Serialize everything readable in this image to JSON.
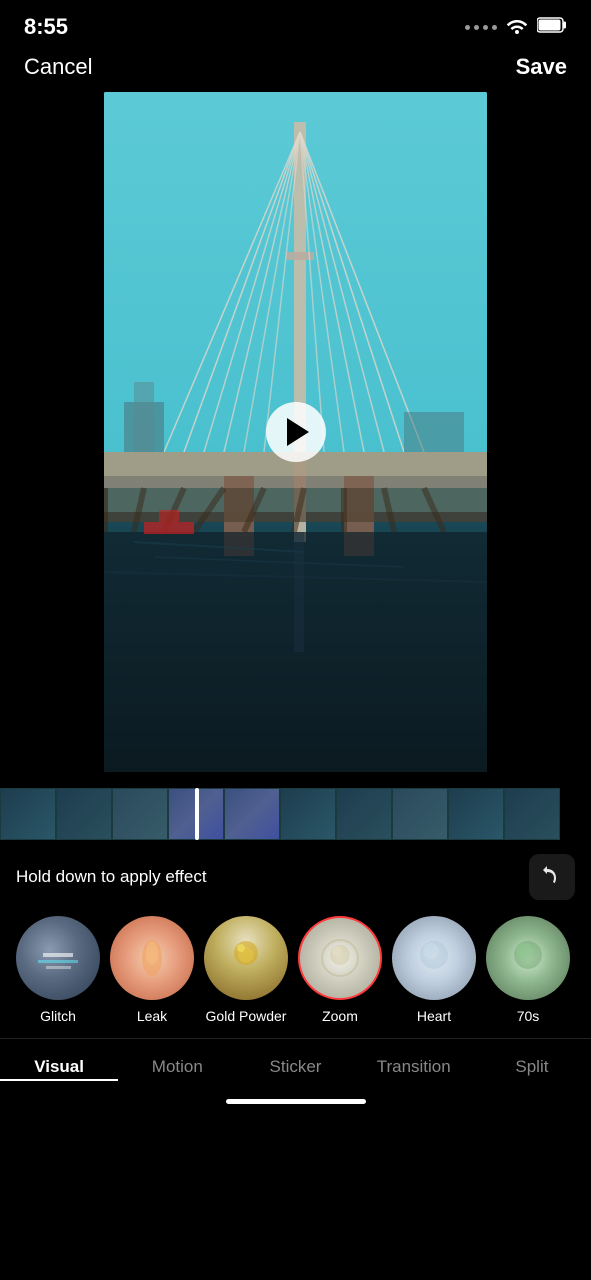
{
  "statusBar": {
    "time": "8:55",
    "ariaLabel": "Status bar"
  },
  "topBar": {
    "cancelLabel": "Cancel",
    "saveLabel": "Save"
  },
  "video": {
    "ariaLabel": "Video preview of bridge",
    "playButtonLabel": "Play"
  },
  "timeline": {
    "ariaLabel": "Video timeline"
  },
  "holdText": "Hold down to apply effect",
  "undoLabel": "Undo",
  "effects": [
    {
      "id": "glitch",
      "label": "Glitch",
      "selected": false,
      "thumbClass": "thumb-glitch"
    },
    {
      "id": "leak",
      "label": "Leak",
      "selected": false,
      "thumbClass": "thumb-leak"
    },
    {
      "id": "gold-powder",
      "label": "Gold Powder",
      "selected": false,
      "thumbClass": "thumb-gold"
    },
    {
      "id": "zoom",
      "label": "Zoom",
      "selected": true,
      "thumbClass": "thumb-zoom"
    },
    {
      "id": "heart",
      "label": "Heart",
      "selected": false,
      "thumbClass": "thumb-heart"
    },
    {
      "id": "70s",
      "label": "70s",
      "selected": false,
      "thumbClass": "thumb-70s"
    }
  ],
  "tabs": [
    {
      "id": "visual",
      "label": "Visual",
      "active": true
    },
    {
      "id": "motion",
      "label": "Motion",
      "active": false
    },
    {
      "id": "sticker",
      "label": "Sticker",
      "active": false
    },
    {
      "id": "transition",
      "label": "Transition",
      "active": false
    },
    {
      "id": "split",
      "label": "Split",
      "active": false
    }
  ]
}
